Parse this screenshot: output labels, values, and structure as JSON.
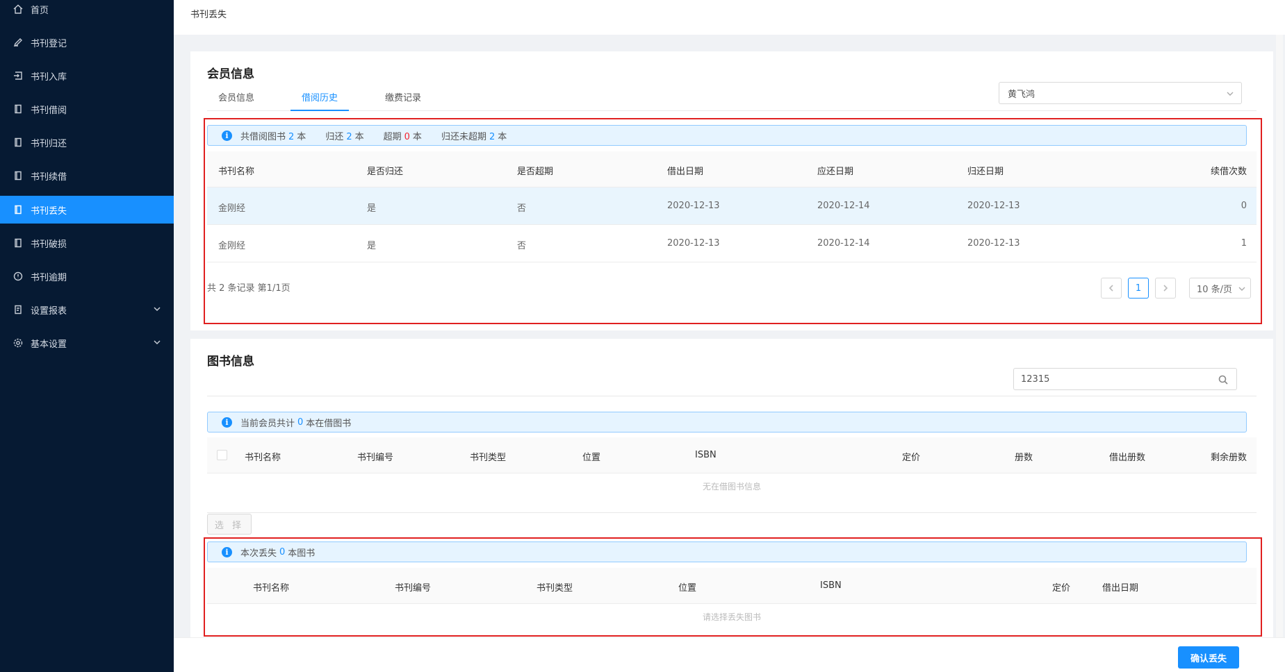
{
  "sidebar": {
    "items": [
      {
        "label": "首页",
        "icon": "home-icon"
      },
      {
        "label": "书刊登记",
        "icon": "pen-icon"
      },
      {
        "label": "书刊入库",
        "icon": "import-icon"
      },
      {
        "label": "书刊借阅",
        "icon": "book-icon"
      },
      {
        "label": "书刊归还",
        "icon": "book-icon"
      },
      {
        "label": "书刊续借",
        "icon": "book-icon"
      },
      {
        "label": "书刊丢失",
        "icon": "book-icon",
        "active": true
      },
      {
        "label": "书刊破损",
        "icon": "book-icon"
      },
      {
        "label": "书刊逾期",
        "icon": "clock-icon"
      },
      {
        "label": "设置报表",
        "icon": "report-icon",
        "expandable": true
      },
      {
        "label": "基本设置",
        "icon": "gear-icon",
        "expandable": true
      }
    ]
  },
  "header": {
    "breadcrumb": "书刊丢失"
  },
  "member": {
    "title": "会员信息",
    "tabs": [
      "会员信息",
      "借阅历史",
      "缴费记录"
    ],
    "active_tab": "借阅历史",
    "member_select": "黄飞鸿",
    "summary": {
      "total_label": "共借阅图书",
      "total": "2",
      "total_unit": "本",
      "returned_label": "归还",
      "returned": "2",
      "returned_unit": "本",
      "overdue_label": "超期",
      "overdue": "0",
      "overdue_unit": "本",
      "ontime_label": "归还未超期",
      "ontime": "2",
      "ontime_unit": "本"
    },
    "table": {
      "columns": [
        "书刊名称",
        "是否归还",
        "是否超期",
        "借出日期",
        "应还日期",
        "归还日期",
        "续借次数"
      ],
      "rows": [
        [
          "金刚经",
          "是",
          "否",
          "2020-12-13",
          "2020-12-14",
          "2020-12-13",
          "0"
        ],
        [
          "金刚经",
          "是",
          "否",
          "2020-12-13",
          "2020-12-14",
          "2020-12-13",
          "1"
        ]
      ]
    },
    "pagination": {
      "summary": "共 2 条记录 第1/1页",
      "current": "1",
      "page_size": "10 条/页"
    }
  },
  "books": {
    "title": "图书信息",
    "search_value": "12315",
    "alert": {
      "prefix": "当前会员共计",
      "count": "0",
      "suffix": "本在借图书"
    },
    "columns": [
      "书刊名称",
      "书刊编号",
      "书刊类型",
      "位置",
      "ISBN",
      "定价",
      "册数",
      "借出册数",
      "剩余册数"
    ],
    "empty_text": "无在借图书信息",
    "select_button": "选 择",
    "lost": {
      "alert": {
        "prefix": "本次丢失",
        "count": "0",
        "suffix": "本图书"
      },
      "columns": [
        "书刊名称",
        "书刊编号",
        "书刊类型",
        "位置",
        "ISBN",
        "定价",
        "借出日期"
      ],
      "empty_text": "请选择丢失图书"
    }
  },
  "footer": {
    "confirm_button": "确认丢失"
  },
  "colors": {
    "primary": "#1890ff",
    "sidebar_bg": "#061a33",
    "danger": "#f5222d",
    "highlight_box": "#e02020"
  }
}
